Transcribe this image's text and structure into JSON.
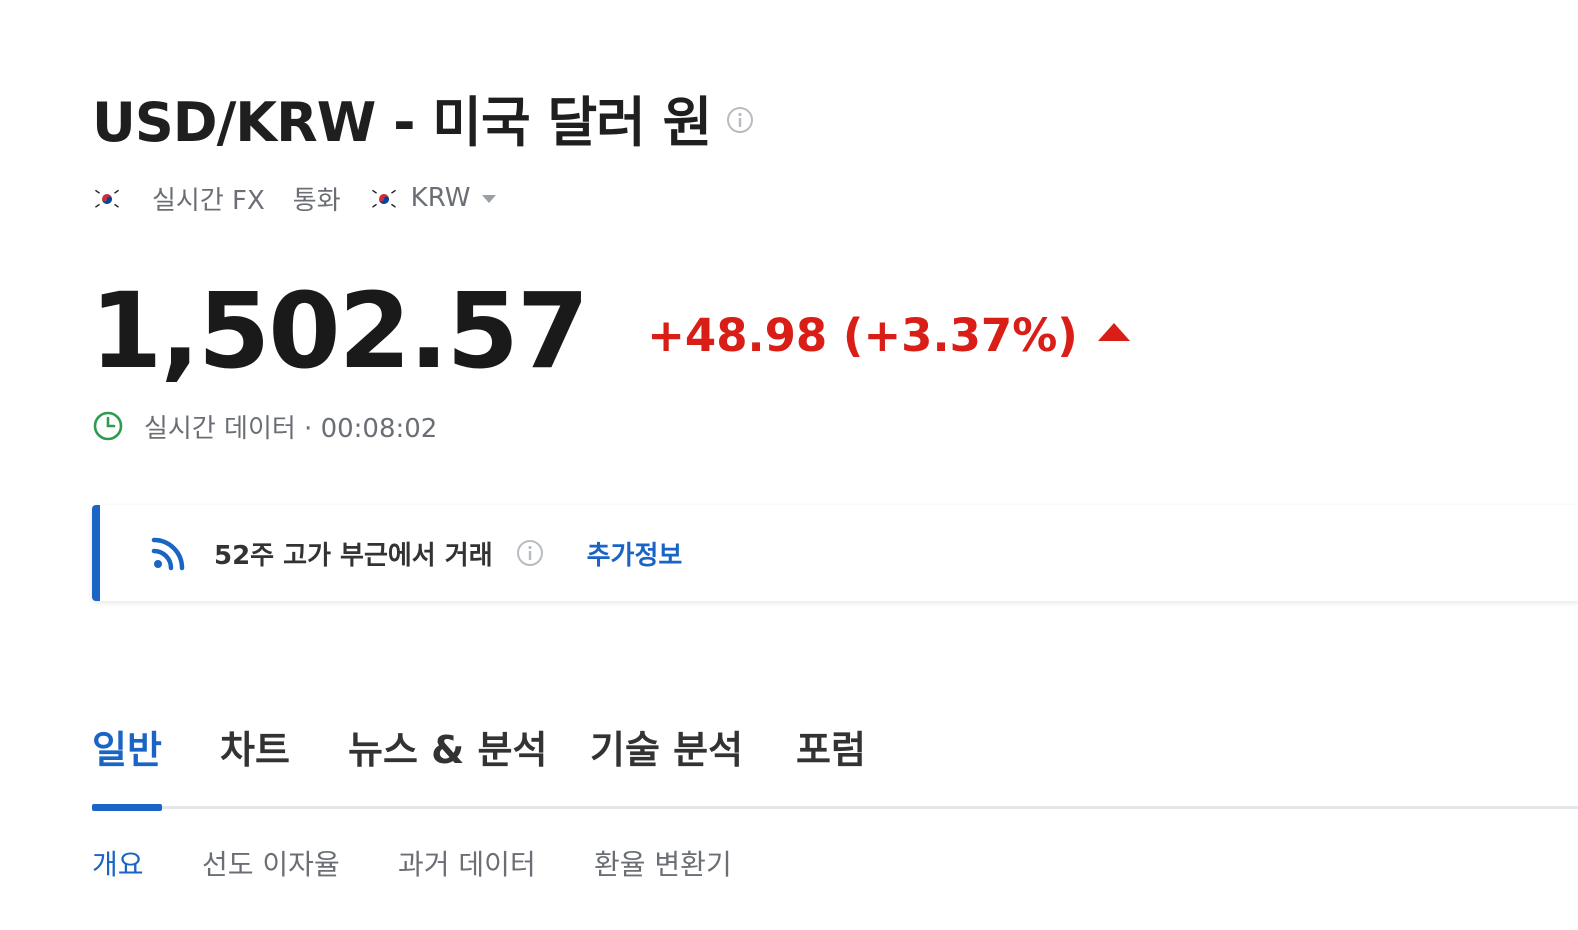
{
  "header": {
    "title": "USD/KRW - 미국 달러 원",
    "info_icon": "info-icon"
  },
  "meta": {
    "flag_icon": "korea-flag-icon",
    "market": "실시간 FX",
    "type": "통화",
    "currency_flag_icon": "korea-flag-icon",
    "currency": "KRW"
  },
  "quote": {
    "price": "1,502.57",
    "change": "+48.98 (+3.37%)",
    "direction_icon": "up-arrow-icon",
    "change_color": "#d91e18"
  },
  "realtime": {
    "icon": "clock-icon",
    "label": "실시간 데이터 · 00:08:02"
  },
  "banner": {
    "icon": "rss-icon",
    "text": "52주 고가 부근에서 거래",
    "info_icon": "info-icon",
    "link": "추가정보",
    "accent": "#1a64c6"
  },
  "tabs": [
    {
      "label": "일반",
      "active": true
    },
    {
      "label": "차트",
      "active": false
    },
    {
      "label": "뉴스 & 분석",
      "active": false
    },
    {
      "label": "기술 분석",
      "active": false
    },
    {
      "label": "포럼",
      "active": false
    }
  ],
  "subtabs": [
    {
      "label": "개요",
      "active": true
    },
    {
      "label": "선도 이자율",
      "active": false
    },
    {
      "label": "과거 데이터",
      "active": false
    },
    {
      "label": "환율 변환기",
      "active": false
    }
  ]
}
